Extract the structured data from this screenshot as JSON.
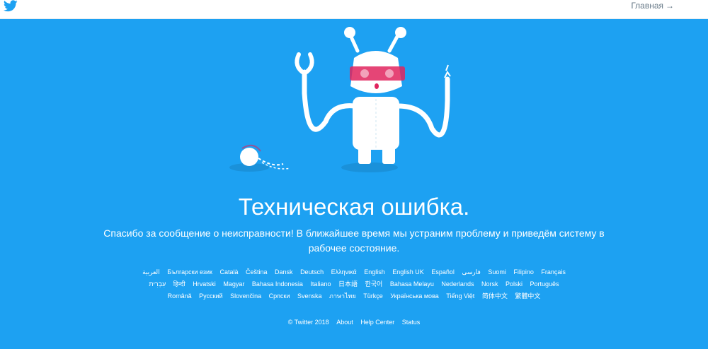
{
  "header": {
    "logo_icon": "twitter-bird-icon",
    "home_label": "Главная",
    "home_arrow": "→"
  },
  "colors": {
    "background": "#1da1f2",
    "robot_white": "#ffffff",
    "robot_visor": "#e0245e"
  },
  "main": {
    "illustration_icon": "broken-robot-icon",
    "headline": "Техническая ошибка.",
    "message": "Спасибо за сообщение о неисправности! В ближайшее время мы устраним проблему и приведём систему в рабочее состояние."
  },
  "languages": [
    "العربية",
    "Български език",
    "Català",
    "Čeština",
    "Dansk",
    "Deutsch",
    "Ελληνικά",
    "English",
    "English UK",
    "Español",
    "فارسی",
    "Suomi",
    "Filipino",
    "Français",
    "עִבְרִית",
    "हिन्दी",
    "Hrvatski",
    "Magyar",
    "Bahasa Indonesia",
    "Italiano",
    "日本語",
    "한국어",
    "Bahasa Melayu",
    "Nederlands",
    "Norsk",
    "Polski",
    "Português",
    "Română",
    "Русский",
    "Slovenčina",
    "Српски",
    "Svenska",
    "ภาษาไทย",
    "Türkçe",
    "Українська мова",
    "Tiếng Việt",
    "简体中文",
    "繁體中文"
  ],
  "footer": {
    "copyright": "© Twitter 2018",
    "links": [
      "About",
      "Help Center",
      "Status"
    ]
  }
}
